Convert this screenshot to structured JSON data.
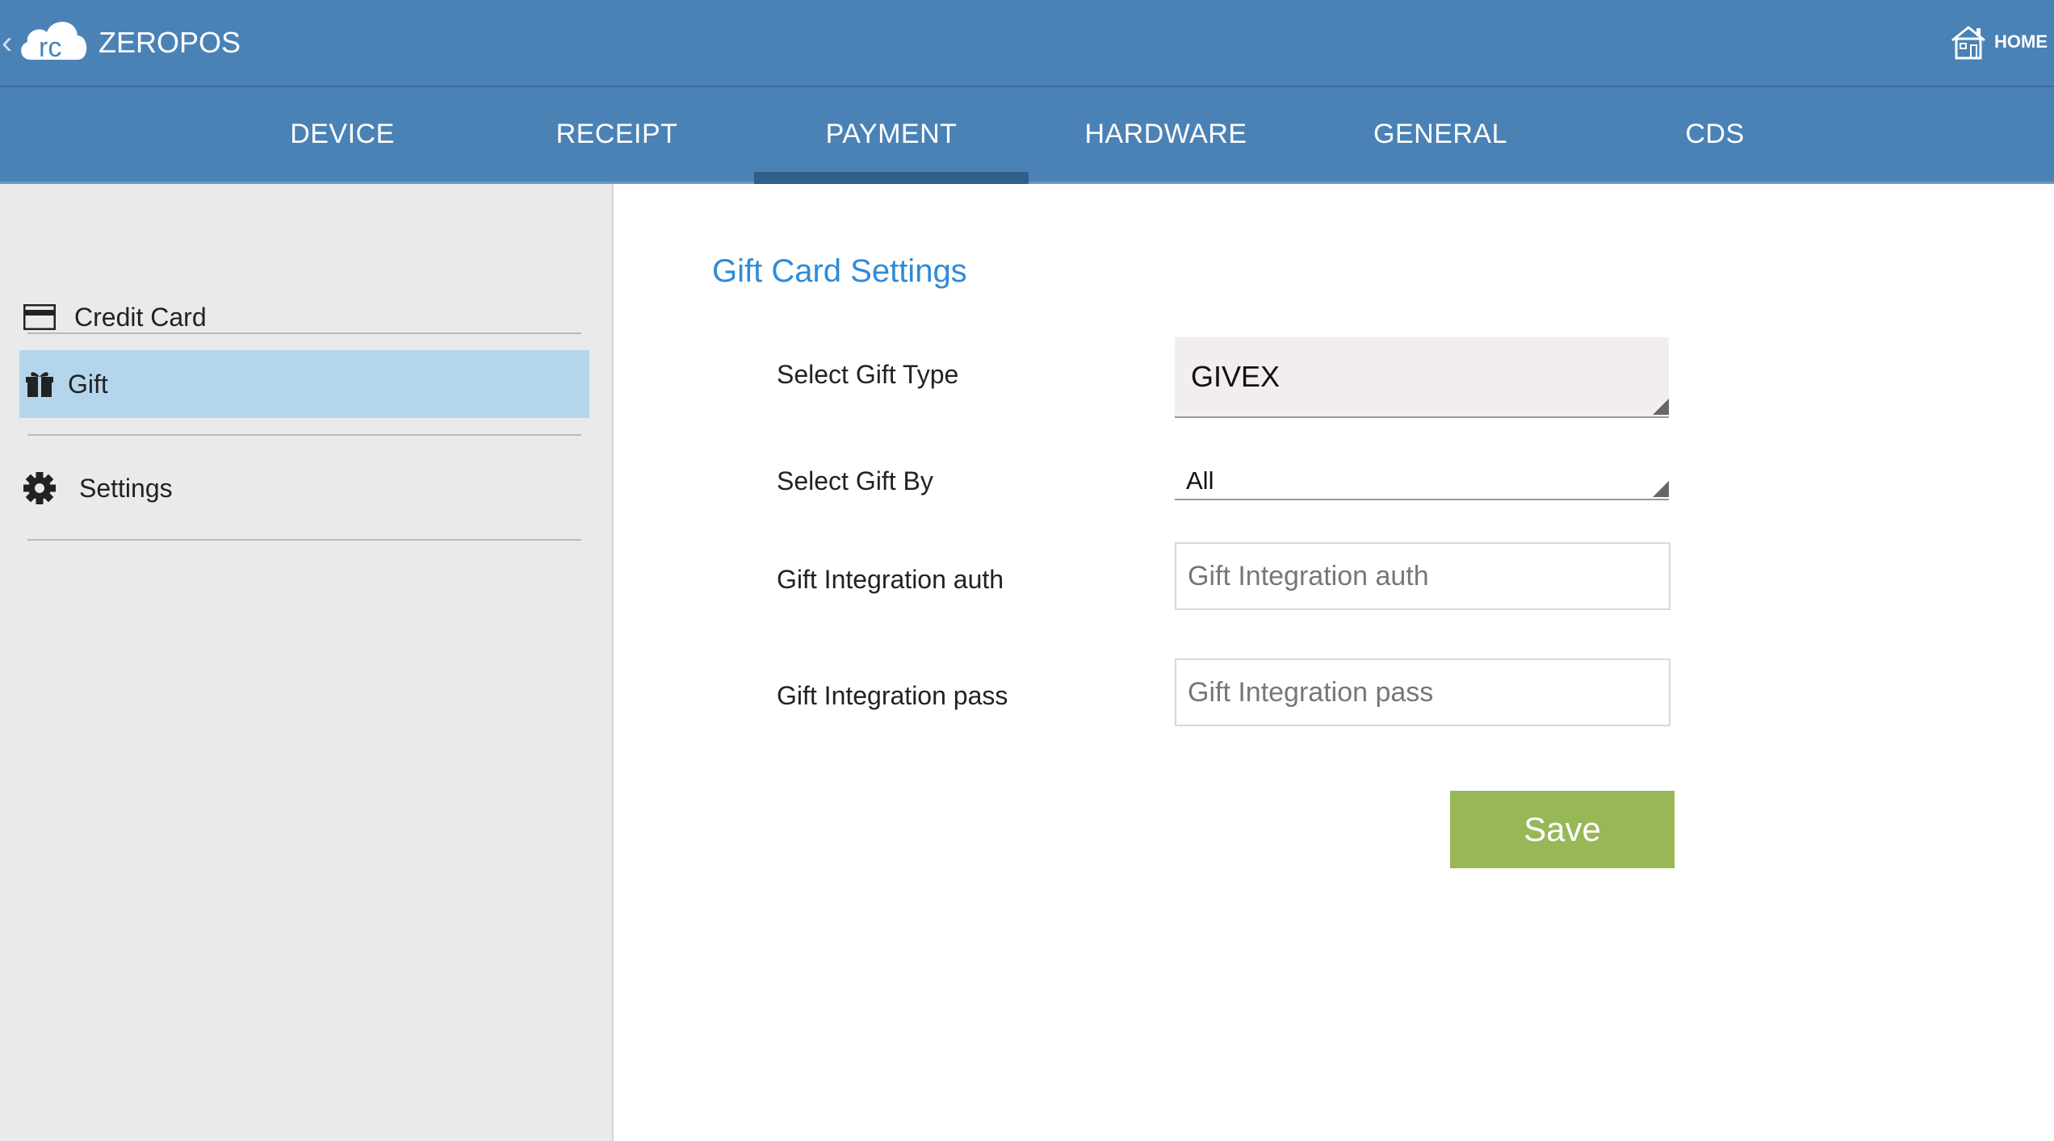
{
  "app": {
    "title": "ZEROPOS",
    "logo_text": "rc",
    "home_label": "HOME"
  },
  "tabs": [
    {
      "label": "DEVICE"
    },
    {
      "label": "RECEIPT"
    },
    {
      "label": "PAYMENT",
      "active": true
    },
    {
      "label": "HARDWARE"
    },
    {
      "label": "GENERAL"
    },
    {
      "label": "CDS"
    }
  ],
  "sidebar": {
    "items": [
      {
        "label": "Credit Card",
        "icon": "credit-card-icon"
      },
      {
        "label": "Gift",
        "icon": "gift-icon",
        "active": true
      },
      {
        "label": "Settings",
        "icon": "gear-icon"
      }
    ]
  },
  "form": {
    "title": "Gift Card Settings",
    "gift_type": {
      "label": "Select Gift Type",
      "value": "GIVEX"
    },
    "gift_by": {
      "label": "Select Gift By",
      "value": "All"
    },
    "auth": {
      "label": "Gift Integration auth",
      "placeholder": "Gift Integration auth",
      "value": ""
    },
    "pass": {
      "label": "Gift Integration pass",
      "placeholder": "Gift Integration pass",
      "value": ""
    },
    "save_label": "Save"
  },
  "colors": {
    "header_blue": "#4a82b6",
    "tab_indicator": "#2f5f8a",
    "sidebar_active": "#b5d5ec",
    "title_blue": "#2f8ad8",
    "save_green": "#98b757"
  }
}
